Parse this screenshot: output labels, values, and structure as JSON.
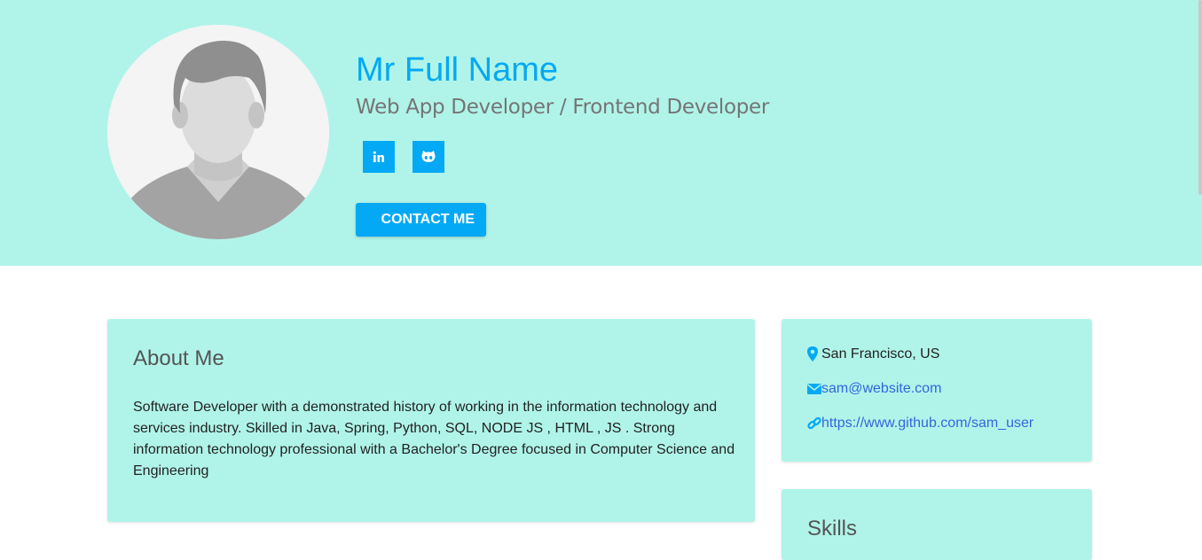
{
  "profile": {
    "name": "Mr Full Name",
    "title": "Web App Developer / Frontend Developer",
    "contact_button": "CONTACT ME"
  },
  "about": {
    "heading": "About Me",
    "text": "Software Developer with a demonstrated history of working in the information technology and services industry. Skilled in Java, Spring, Python, SQL, NODE JS , HTML , JS . Strong information technology professional with a Bachelor's Degree focused in Computer Science and Engineering"
  },
  "info": {
    "location": "San Francisco, US",
    "email": "sam@website.com",
    "website": "https://www.github.com/sam_user"
  },
  "skills": {
    "heading": "Skills"
  },
  "icons": {
    "linkedin": "linkedin-icon",
    "github": "github-icon",
    "location": "map-marker-icon",
    "email": "envelope-icon",
    "link": "link-icon"
  },
  "colors": {
    "header_bg": "#b0f4e9",
    "accent": "#03a9f4",
    "card_bg": "#b0f4e9",
    "link": "#3366dd"
  }
}
